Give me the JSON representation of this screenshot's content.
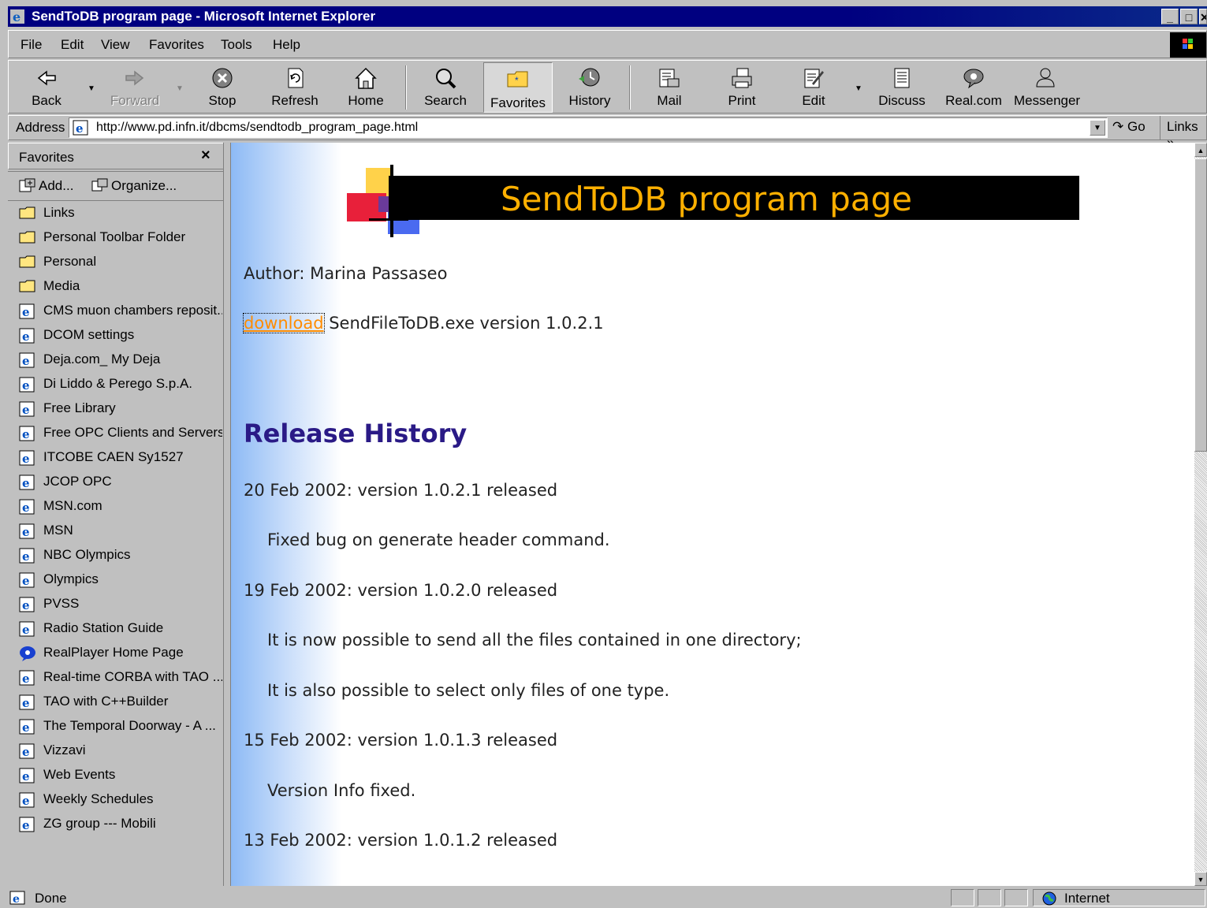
{
  "window": {
    "title": "SendToDB program page - Microsoft Internet Explorer",
    "controls": [
      "_",
      "□",
      "✕"
    ]
  },
  "menu": [
    "File",
    "Edit",
    "View",
    "Favorites",
    "Tools",
    "Help"
  ],
  "toolbar": {
    "back": "Back",
    "forward": "Forward",
    "stop": "Stop",
    "refresh": "Refresh",
    "home": "Home",
    "search": "Search",
    "favorites": "Favorites",
    "history": "History",
    "mail": "Mail",
    "print": "Print",
    "edit": "Edit",
    "discuss": "Discuss",
    "realcom": "Real.com",
    "messenger": "Messenger"
  },
  "address": {
    "label": "Address",
    "url": "http://www.pd.infn.it/dbcms/sendtodb_program_page.html",
    "go": "Go",
    "links": "Links"
  },
  "favorites_pane": {
    "title": "Favorites",
    "add": "Add...",
    "organize": "Organize...",
    "items": [
      {
        "label": "Links",
        "icon": "folder-icon"
      },
      {
        "label": "Personal Toolbar Folder",
        "icon": "folder-icon"
      },
      {
        "label": "Personal",
        "icon": "folder-icon"
      },
      {
        "label": "Media",
        "icon": "folder-icon"
      },
      {
        "label": "CMS muon chambers reposit...",
        "icon": "ie-page-icon"
      },
      {
        "label": "DCOM settings",
        "icon": "ie-page-icon"
      },
      {
        "label": "Deja.com_ My Deja",
        "icon": "ie-page-icon"
      },
      {
        "label": "Di Liddo & Perego S.p.A.",
        "icon": "ie-page-icon"
      },
      {
        "label": "Free Library",
        "icon": "ie-page-icon"
      },
      {
        "label": "Free OPC Clients and Servers",
        "icon": "ie-page-icon"
      },
      {
        "label": "ITCOBE CAEN Sy1527",
        "icon": "ie-page-icon"
      },
      {
        "label": "JCOP OPC",
        "icon": "ie-page-icon"
      },
      {
        "label": "MSN.com",
        "icon": "ie-page-icon"
      },
      {
        "label": "MSN",
        "icon": "ie-page-icon"
      },
      {
        "label": "NBC Olympics",
        "icon": "ie-page-icon"
      },
      {
        "label": "Olympics",
        "icon": "ie-page-icon"
      },
      {
        "label": "PVSS",
        "icon": "ie-page-icon"
      },
      {
        "label": "Radio Station Guide",
        "icon": "ie-page-icon"
      },
      {
        "label": "RealPlayer Home Page",
        "icon": "realplayer-icon"
      },
      {
        "label": "Real-time CORBA with TAO ...",
        "icon": "ie-page-icon"
      },
      {
        "label": "TAO with C++Builder",
        "icon": "ie-page-icon"
      },
      {
        "label": "The Temporal Doorway - A ...",
        "icon": "ie-page-icon"
      },
      {
        "label": "Vizzavi",
        "icon": "ie-page-icon"
      },
      {
        "label": "Web Events",
        "icon": "ie-page-icon"
      },
      {
        "label": "Weekly Schedules",
        "icon": "ie-page-icon"
      },
      {
        "label": "ZG group --- Mobili",
        "icon": "ie-page-icon"
      }
    ]
  },
  "page": {
    "banner_title": "SendToDB program page",
    "author": "Author: Marina Passaseo",
    "download_link": "download",
    "download_text": " SendFileToDB.exe version 1.0.2.1",
    "release_heading": "Release History",
    "releases": [
      "20 Feb 2002: version 1.0.2.1 released",
      "Fixed bug on generate header command.",
      "19 Feb 2002: version 1.0.2.0 released",
      "It is now possible to send all the files contained in one directory;",
      "It is also possible to select only files of one type.",
      "15 Feb 2002: version 1.0.1.3 released",
      "Version Info fixed.",
      "13 Feb 2002: version 1.0.1.2 released"
    ]
  },
  "status": {
    "text": "Done",
    "zone": "Internet"
  },
  "colors": {
    "titlebar": "#000080",
    "banner_text": "#ffb000",
    "heading": "#2a1a86",
    "link": "#ff8c00"
  }
}
